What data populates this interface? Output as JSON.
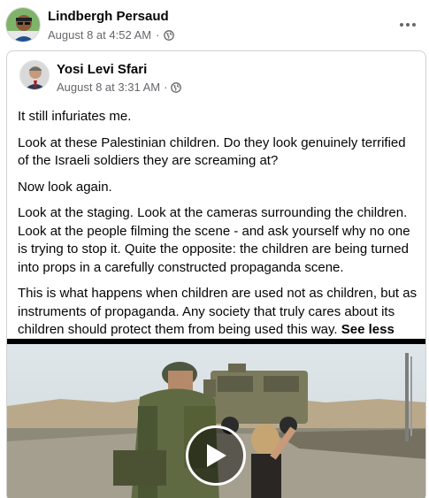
{
  "post": {
    "author": "Lindbergh Persaud",
    "date": "August 8 at 4:52 AM",
    "separator": "·",
    "more_icon": "more-dots-icon",
    "privacy_icon": "globe-icon"
  },
  "shared": {
    "author": "Yosi Levi Sfari",
    "date": "August 8 at 3:31 AM",
    "separator": "·",
    "privacy_icon": "globe-icon",
    "paragraphs": [
      "It still infuriates me.",
      "Look at these Palestinian children. Do they look genuinely terrified of the Israeli soldiers they are screaming at?",
      "Now look again.",
      "Look at the staging. Look at the cameras surrounding the children. Look at the people filming the scene - and ask yourself why no one is trying to stop it. Quite the opposite: the children are being turned into props in a carefully constructed propaganda scene.",
      "This is what happens when children are used not as children, but as instruments of propaganda. Any society that truly cares about its children should protect them from being used this way."
    ],
    "see_less": "See less",
    "video_icon": "play-icon"
  },
  "colors": {
    "text": "#050505",
    "meta": "#65676b",
    "border": "#ced0d4"
  }
}
